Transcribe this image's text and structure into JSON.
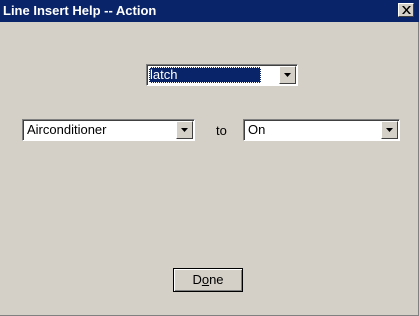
{
  "window": {
    "title": "Line Insert Help -- Action",
    "close_glyph": "close-icon"
  },
  "action_select": {
    "value": "latch"
  },
  "device_select": {
    "value": "Airconditioner"
  },
  "connector_label": "to",
  "state_select": {
    "value": "On"
  },
  "done_button": {
    "label_pre": "D",
    "label_mnemonic": "o",
    "label_post": "ne"
  },
  "colors": {
    "titlebar": "#0a246a",
    "face": "#d4d0c8",
    "selection": "#0a246a"
  }
}
